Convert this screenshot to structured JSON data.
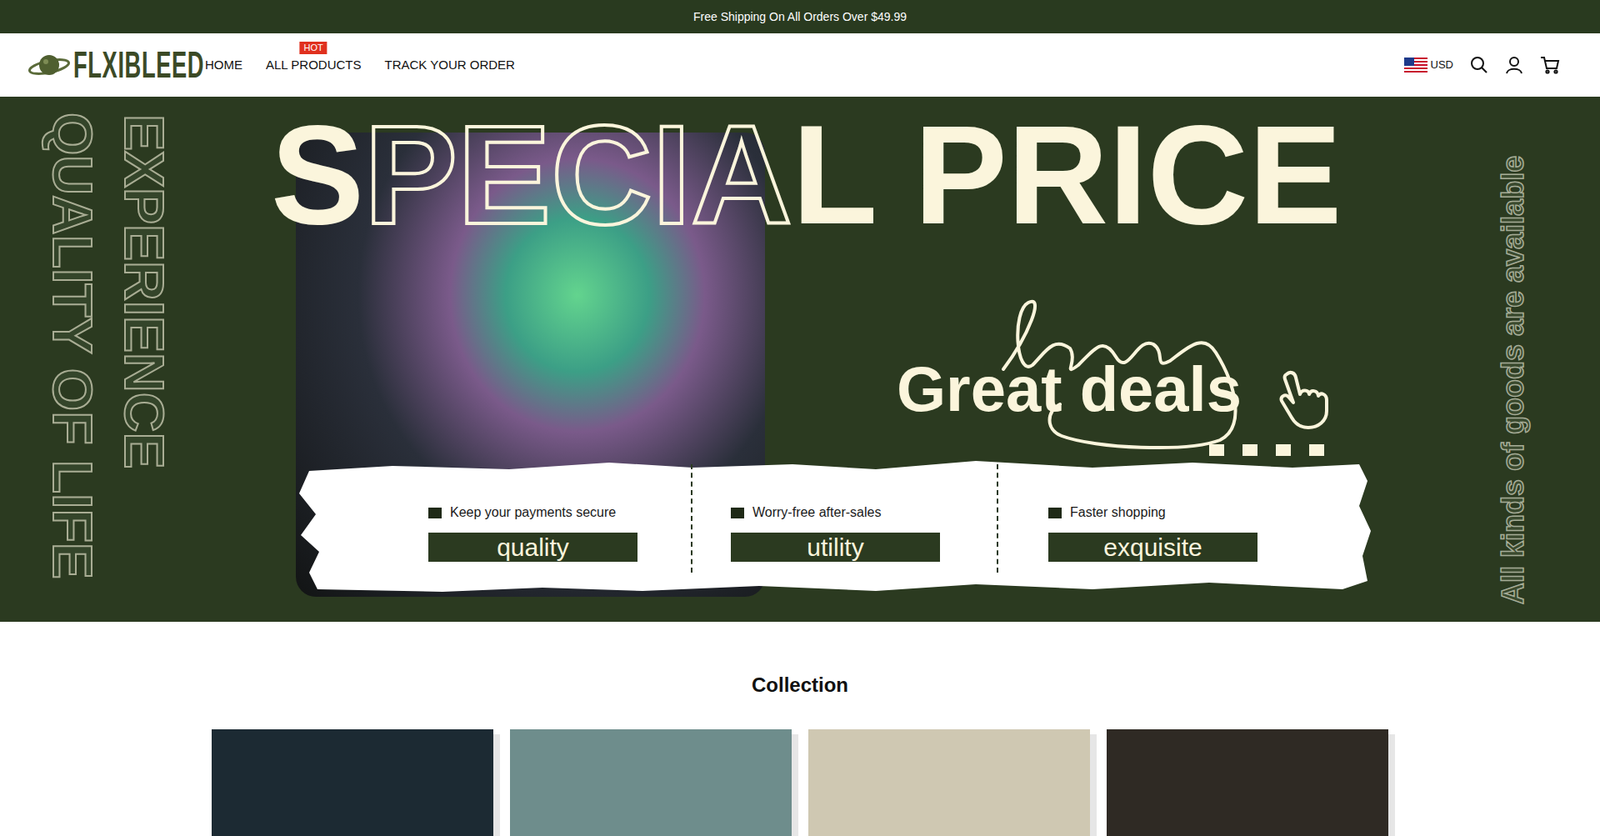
{
  "announcement": "Free Shipping On All Orders Over $49.99",
  "logo": "FLXIBLEED",
  "nav": [
    {
      "label": "HOME"
    },
    {
      "label": "ALL PRODUCTS",
      "badge": "HOT"
    },
    {
      "label": "TRACK YOUR ORDER"
    }
  ],
  "currency": "USD",
  "hero": {
    "side_left": [
      "QUALITY OF LIFE",
      "EXPERIENCE"
    ],
    "side_right": "All kinds of goods are available",
    "headline": [
      {
        "text": "S",
        "kind": "solid"
      },
      {
        "text": "PECIA",
        "kind": "outline"
      },
      {
        "text": "L PRICE",
        "kind": "solid"
      }
    ],
    "tagline": "Great deals",
    "features": [
      {
        "caption": "Keep your payments secure",
        "label": "quality"
      },
      {
        "caption": "Worry-free after-sales",
        "label": "utility"
      },
      {
        "caption": "Faster shopping",
        "label": "exquisite"
      }
    ]
  },
  "collection": {
    "title": "Collection",
    "cards": [
      {
        "color": "#1c2a33"
      },
      {
        "color": "#6e8d8c"
      },
      {
        "color": "#cfc8b2"
      },
      {
        "color": "#2f2a24"
      }
    ]
  }
}
